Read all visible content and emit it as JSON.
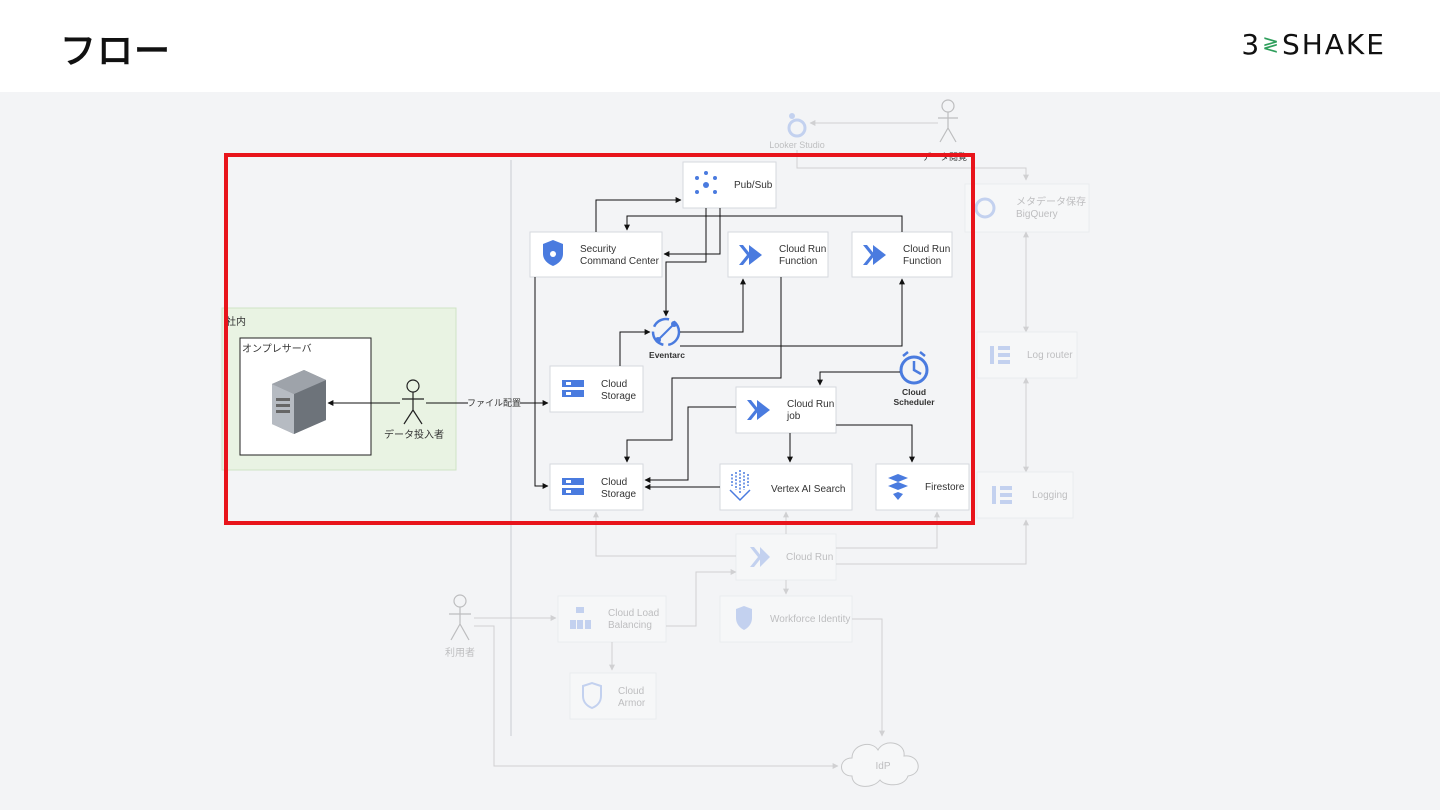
{
  "slide": {
    "title": "フロー",
    "logo_left": "3",
    "logo_mark": "≷",
    "logo_right": "SHAKE"
  },
  "diagram": {
    "onprem_zone_label": "社内",
    "onprem_server_label": "オンプレサーバ",
    "data_uploader": "データ投入者",
    "file_place": "ファイル配置",
    "pubsub": "Pub/Sub",
    "scc_line1": "Security",
    "scc_line2": "Command Center",
    "crf1_line1": "Cloud Run",
    "crf1_line2": "Function",
    "crf2_line1": "Cloud Run",
    "crf2_line2": "Function",
    "eventarc": "Eventarc",
    "storage_top_line1": "Cloud",
    "storage_top_line2": "Storage",
    "scheduler_line1": "Cloud",
    "scheduler_line2": "Scheduler",
    "crjob_line1": "Cloud Run",
    "crjob_line2": "job",
    "storage_bottom_line1": "Cloud",
    "storage_bottom_line2": "Storage",
    "vertex": "Vertex AI Search",
    "firestore": "Firestore",
    "looker": "Looker Studio",
    "looker_note": "データ閲覧",
    "metadata_line1": "メタデータ保存",
    "metadata_line2": "BigQuery",
    "log_router": "Log router",
    "logging": "Logging",
    "cloud_run": "Cloud Run",
    "user": "利用者",
    "lb_line1": "Cloud Load",
    "lb_line2": "Balancing",
    "workforce": "Workforce Identity",
    "armor_line1": "Cloud",
    "armor_line2": "Armor",
    "idp": "IdP"
  },
  "colors": {
    "highlight": "#e8141b",
    "accent": "#4a7bdf",
    "onprem_zone": "#e9f3e3"
  }
}
